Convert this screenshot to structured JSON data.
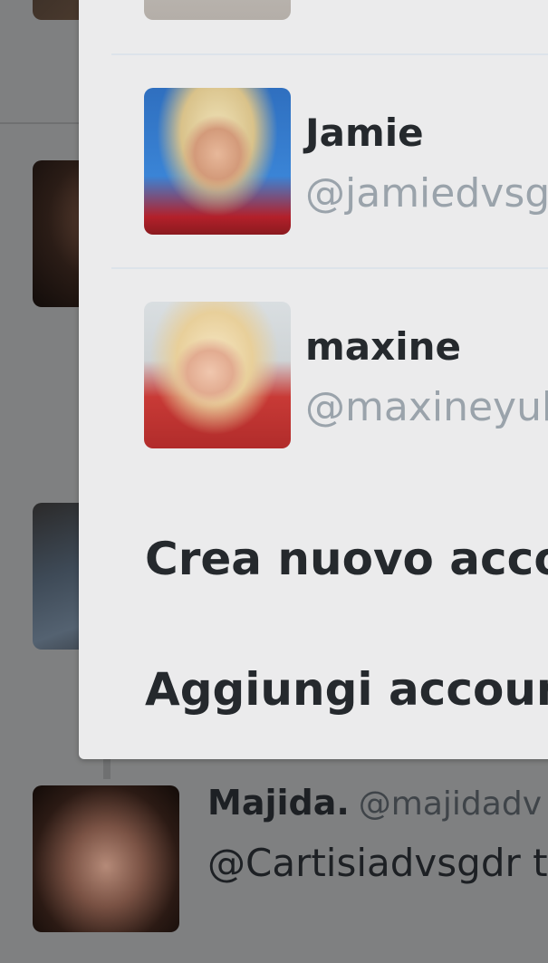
{
  "timeline": {
    "tweet": {
      "name": "Majida.",
      "handle": "@majidadv",
      "text": "@Cartisiadvsgdr t"
    }
  },
  "account_menu": {
    "accounts": [
      {
        "name": "Jamie",
        "handle": "@jamiedvsgd"
      },
      {
        "name": "maxine",
        "handle": "@maxineyuk"
      }
    ],
    "actions": {
      "create_new": "Crea nuovo accoun",
      "add_existing": "Aggiungi account e"
    }
  }
}
